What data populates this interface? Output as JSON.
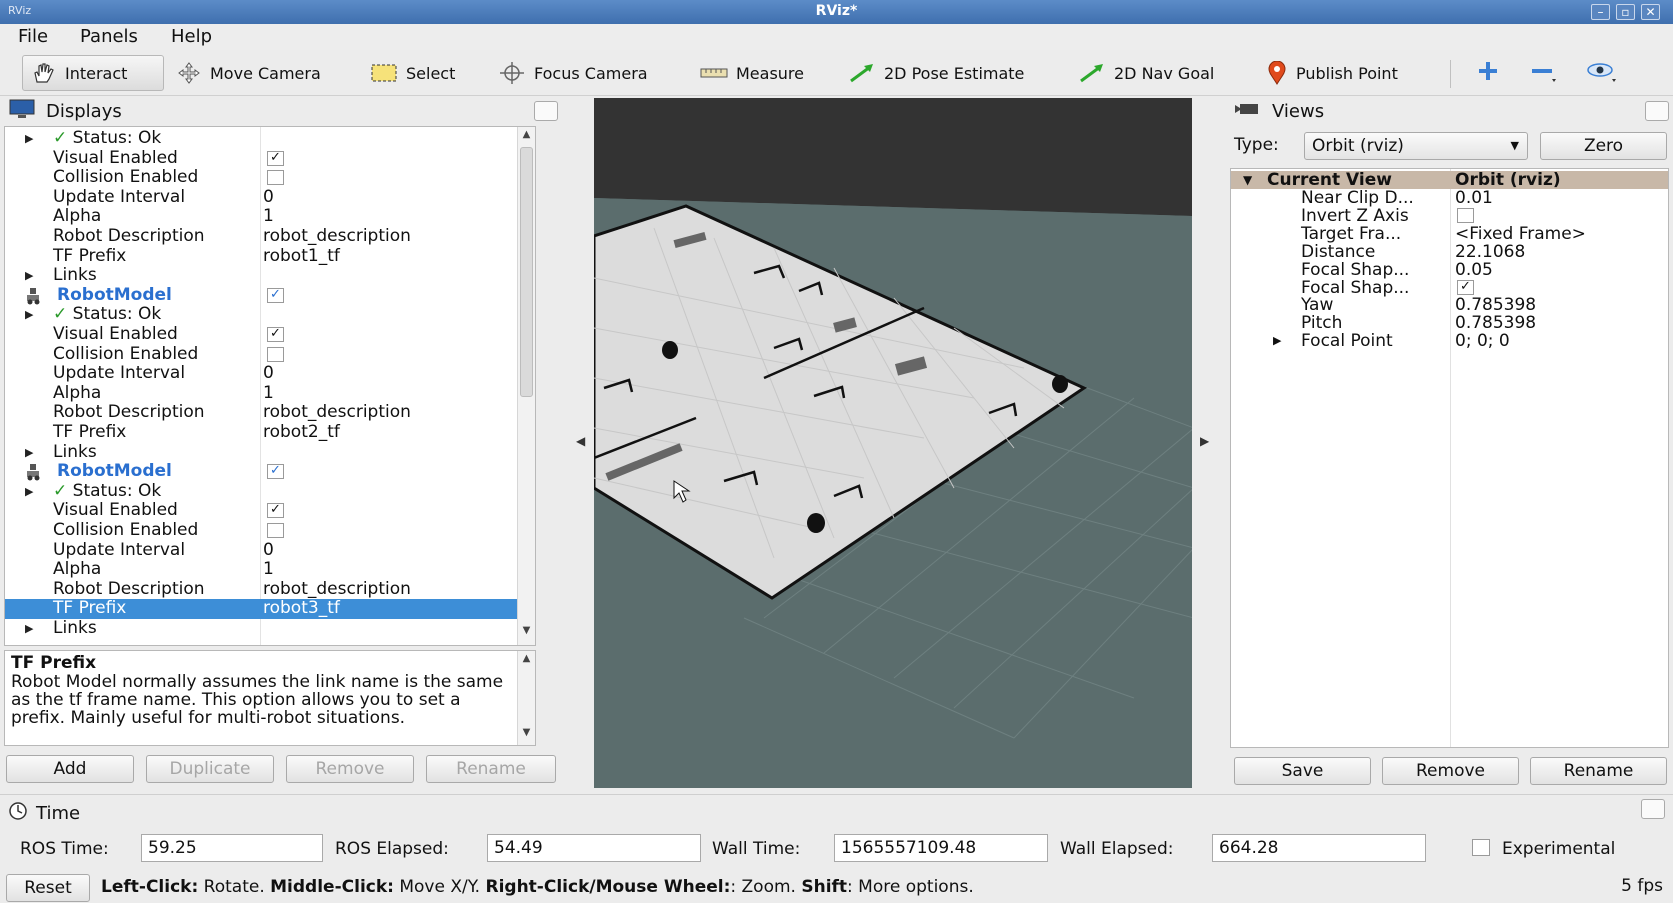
{
  "window": {
    "title": "RViz*",
    "app_icon": "RViz"
  },
  "menu": {
    "file": "File",
    "panels": "Panels",
    "help": "Help"
  },
  "toolbar": {
    "interact": "Interact",
    "move_camera": "Move Camera",
    "select": "Select",
    "focus_camera": "Focus Camera",
    "measure": "Measure",
    "pose_estimate": "2D Pose Estimate",
    "nav_goal": "2D Nav Goal",
    "publish_point": "Publish Point"
  },
  "displays": {
    "title": "Displays",
    "rows": [
      {
        "key": "Status: Ok",
        "value": "",
        "type": "status"
      },
      {
        "key": "Visual Enabled",
        "value": "",
        "type": "check",
        "checked": true
      },
      {
        "key": "Collision Enabled",
        "value": "",
        "type": "check",
        "checked": false
      },
      {
        "key": "Update Interval",
        "value": "0",
        "type": "prop"
      },
      {
        "key": "Alpha",
        "value": "1",
        "type": "prop"
      },
      {
        "key": "Robot Description",
        "value": "robot_description",
        "type": "prop"
      },
      {
        "key": "TF Prefix",
        "value": "robot1_tf",
        "type": "prop"
      },
      {
        "key": "Links",
        "value": "",
        "type": "group"
      },
      {
        "key": "RobotModel",
        "value": "",
        "type": "robot",
        "checked": true
      },
      {
        "key": "Status: Ok",
        "value": "",
        "type": "status"
      },
      {
        "key": "Visual Enabled",
        "value": "",
        "type": "check",
        "checked": true
      },
      {
        "key": "Collision Enabled",
        "value": "",
        "type": "check",
        "checked": false
      },
      {
        "key": "Update Interval",
        "value": "0",
        "type": "prop"
      },
      {
        "key": "Alpha",
        "value": "1",
        "type": "prop"
      },
      {
        "key": "Robot Description",
        "value": "robot_description",
        "type": "prop"
      },
      {
        "key": "TF Prefix",
        "value": "robot2_tf",
        "type": "prop"
      },
      {
        "key": "Links",
        "value": "",
        "type": "group"
      },
      {
        "key": "RobotModel",
        "value": "",
        "type": "robot",
        "checked": true
      },
      {
        "key": "Status: Ok",
        "value": "",
        "type": "status"
      },
      {
        "key": "Visual Enabled",
        "value": "",
        "type": "check",
        "checked": true
      },
      {
        "key": "Collision Enabled",
        "value": "",
        "type": "check",
        "checked": false
      },
      {
        "key": "Update Interval",
        "value": "0",
        "type": "prop"
      },
      {
        "key": "Alpha",
        "value": "1",
        "type": "prop"
      },
      {
        "key": "Robot Description",
        "value": "robot_description",
        "type": "prop"
      },
      {
        "key": "TF Prefix",
        "value": "robot3_tf",
        "type": "prop",
        "selected": true
      },
      {
        "key": "Links",
        "value": "",
        "type": "group"
      }
    ],
    "description_title": "TF Prefix",
    "description_body": "Robot Model normally assumes the link name is the same as the tf frame name. This option allows you to set a prefix. Mainly useful for multi-robot situations.",
    "buttons": {
      "add": "Add",
      "duplicate": "Duplicate",
      "remove": "Remove",
      "rename": "Rename"
    }
  },
  "views": {
    "title": "Views",
    "type_label": "Type:",
    "type_value": "Orbit (rviz)",
    "zero": "Zero",
    "current_view": {
      "key": "Current View",
      "value": "Orbit (rviz)"
    },
    "rows": [
      {
        "key": "Near Clip D...",
        "value": "0.01"
      },
      {
        "key": "Invert Z Axis",
        "value": "",
        "check": true,
        "checked": false
      },
      {
        "key": "Target Fra...",
        "value": "<Fixed Frame>"
      },
      {
        "key": "Distance",
        "value": "22.1068"
      },
      {
        "key": "Focal Shap...",
        "value": "0.05"
      },
      {
        "key": "Focal Shap...",
        "value": "",
        "check": true,
        "checked": true
      },
      {
        "key": "Yaw",
        "value": "0.785398"
      },
      {
        "key": "Pitch",
        "value": "0.785398"
      },
      {
        "key": "Focal Point",
        "value": "0; 0; 0",
        "expandable": true
      }
    ],
    "buttons": {
      "save": "Save",
      "remove": "Remove",
      "rename": "Rename"
    }
  },
  "time": {
    "title": "Time",
    "ros_time_label": "ROS Time:",
    "ros_time": "59.25",
    "ros_elapsed_label": "ROS Elapsed:",
    "ros_elapsed": "54.49",
    "wall_time_label": "Wall Time:",
    "wall_time": "1565557109.48",
    "wall_elapsed_label": "Wall Elapsed:",
    "wall_elapsed": "664.28",
    "experimental": "Experimental"
  },
  "status": {
    "reset": "Reset",
    "hint_parts": [
      {
        "b": "Left-Click:",
        "t": " Rotate. "
      },
      {
        "b": "Middle-Click:",
        "t": " Move X/Y. "
      },
      {
        "b": "Right-Click/Mouse Wheel:",
        "t": ": Zoom. "
      },
      {
        "b": "Shift",
        "t": ": More options."
      }
    ],
    "fps": "5 fps"
  },
  "colors": {
    "selection": "#3d8ed7",
    "robot_name": "#2a6fcf",
    "view_bg": "#5b6d6d",
    "map_floor": "#dcdcdc"
  }
}
